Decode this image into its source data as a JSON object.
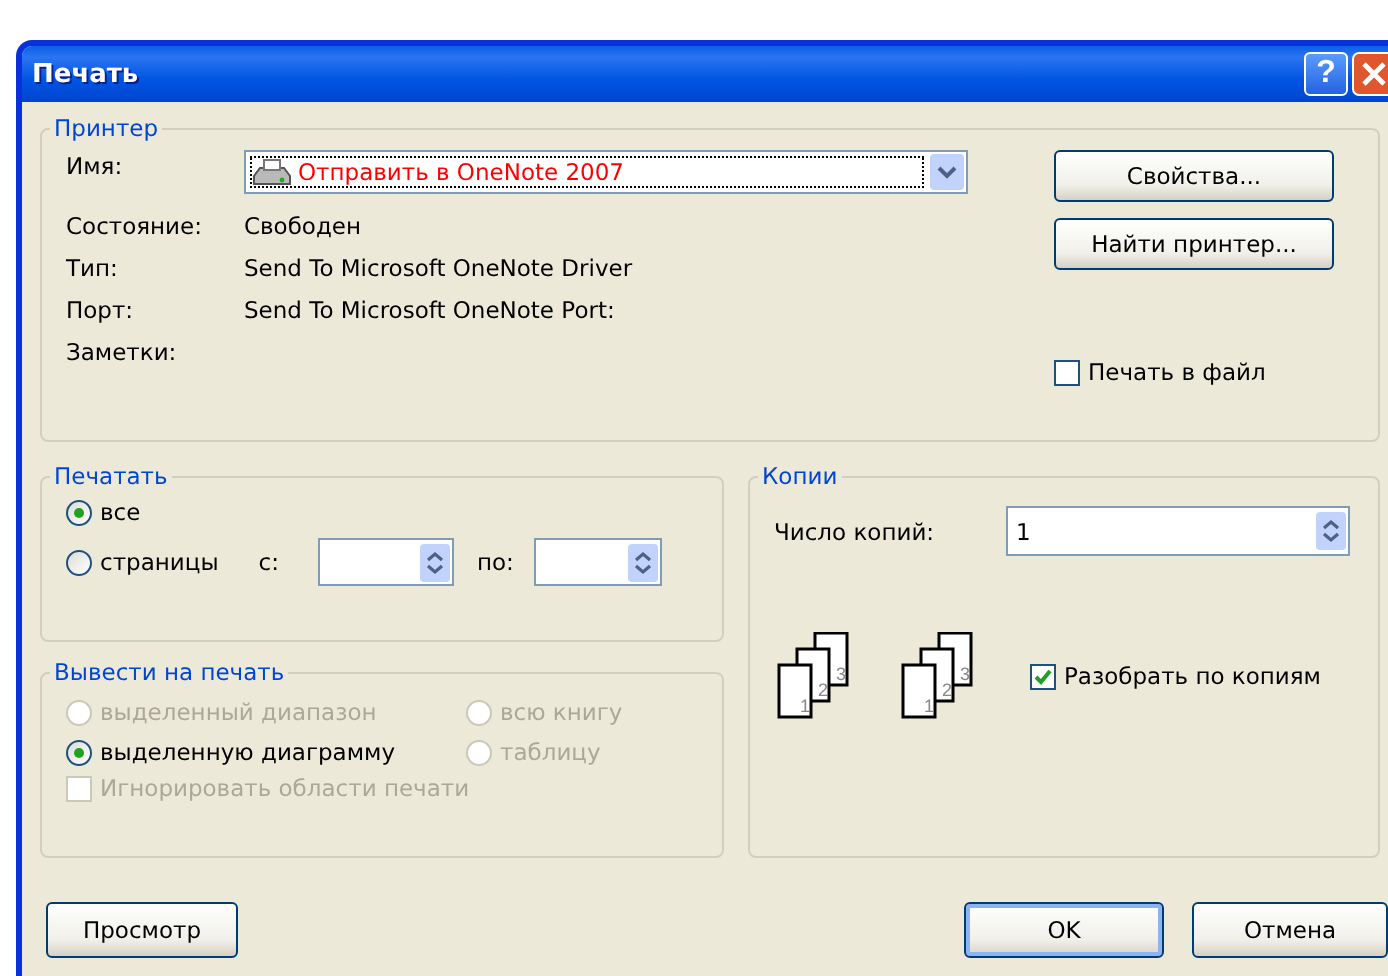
{
  "window": {
    "title": "Печать",
    "help_button": "?"
  },
  "printer": {
    "legend": "Принтер",
    "name_label": "Имя:",
    "name_value": "Отправить в OneNote 2007",
    "info": [
      {
        "label": "Состояние:",
        "value": "Свободен"
      },
      {
        "label": "Тип:",
        "value": "Send To Microsoft OneNote Driver"
      },
      {
        "label": "Порт:",
        "value": "Send To Microsoft OneNote Port:"
      },
      {
        "label": "Заметки:"
      }
    ],
    "buttons": [
      "Свойства...",
      "Найти принтер..."
    ],
    "print_to_file": {
      "label": "Печать в файл",
      "checked": false
    }
  },
  "print_range": {
    "legend": "Печатать",
    "options": [
      {
        "label": "все",
        "selected": true
      },
      {
        "label": "страницы",
        "selected": false
      }
    ],
    "from_label": "с:",
    "to_label": "по:"
  },
  "print_what": {
    "legend": "Вывести на печать",
    "options": [
      {
        "label": "выделенный диапазон",
        "selected": false,
        "disabled": true
      },
      {
        "label": "всю книгу",
        "selected": false,
        "disabled": true
      },
      {
        "label": "выделенную диаграмму",
        "selected": true,
        "disabled": false
      },
      {
        "label": "таблицу",
        "selected": false,
        "disabled": true
      }
    ],
    "ignore_print_areas": {
      "label": "Игнорировать области печати",
      "checked": false,
      "disabled": true
    }
  },
  "copies": {
    "legend": "Копии",
    "count_label": "Число копий:",
    "count_value": "1",
    "page_stacks": [
      [
        "1",
        "2",
        "3"
      ],
      [
        "1",
        "2",
        "3"
      ]
    ],
    "collate": {
      "label": "Разобрать по копиям",
      "checked": true
    }
  },
  "footer": {
    "preview": "Просмотр",
    "ok": "OK",
    "cancel": "Отмена"
  }
}
